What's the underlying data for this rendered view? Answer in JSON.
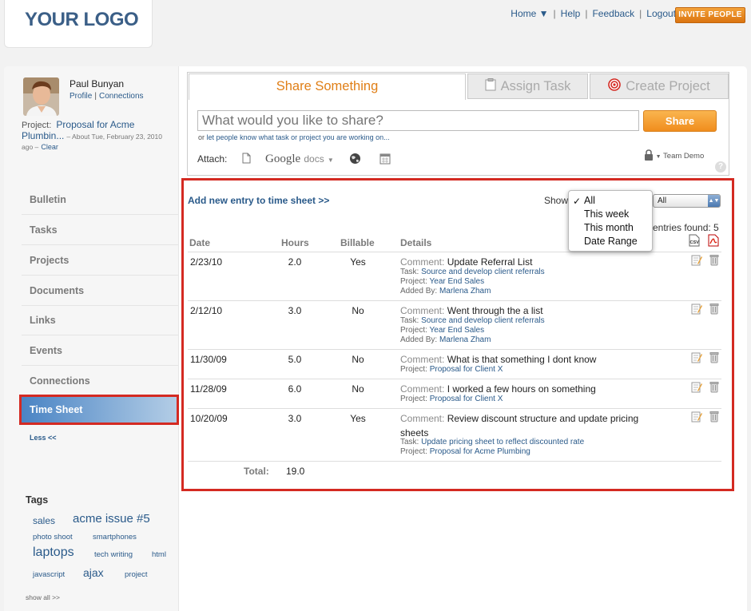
{
  "header": {
    "logo": "YOUR LOGO",
    "nav": [
      "Home ▼",
      "Help",
      "Feedback",
      "Logout"
    ],
    "invite": "INVITE PEOPLE"
  },
  "user": {
    "name": "Paul Bunyan",
    "profile": "Profile",
    "connections": "Connections",
    "project_label": "Project:",
    "project_name": "Proposal for Acme Plumbin...",
    "project_meta": "– About Tue, February 23, 2010 ago –",
    "clear": "Clear"
  },
  "sidebar": {
    "items": [
      "Bulletin",
      "Tasks",
      "Projects",
      "Documents",
      "Links",
      "Events",
      "Connections"
    ],
    "active": "Time Sheet",
    "less": "Less <<"
  },
  "tags": {
    "title": "Tags",
    "items": [
      "sales",
      "acme issue #5",
      "photo shoot",
      "smartphones",
      "laptops",
      "tech writing",
      "html",
      "javascript",
      "ajax",
      "project"
    ],
    "show_all": "show all >>"
  },
  "share": {
    "tabs": [
      "Share Something",
      "Assign Task",
      "Create Project"
    ],
    "placeholder": "What would you like to share?",
    "button": "Share",
    "hint_or": "or",
    "hint_link": "let people know what task or project you are working on...",
    "attach": "Attach:",
    "google": "Google",
    "docs": "docs",
    "team": "Team Demo"
  },
  "timesheet": {
    "add_entry": "Add new entry to time sheet >>",
    "show_label": "Show",
    "select_value": "All",
    "dropdown": [
      "All",
      "This week",
      "This month",
      "Date Range"
    ],
    "dropdown_checked": "✓",
    "entries_found": "entries found: 5",
    "columns": [
      "Date",
      "Hours",
      "Billable",
      "Details"
    ],
    "comment_label": "Comment:",
    "task_label": "Task:",
    "project_label": "Project:",
    "added_label": "Added By:",
    "rows": [
      {
        "date": "2/23/10",
        "hours": "2.0",
        "billable": "Yes",
        "comment": "Update Referral List",
        "task": "Source and develop client referrals",
        "project": "Year End Sales",
        "added_by": "Marlena Zham"
      },
      {
        "date": "2/12/10",
        "hours": "3.0",
        "billable": "No",
        "comment": "Went through the a list",
        "task": "Source and develop client referrals",
        "project": "Year End Sales",
        "added_by": "Marlena Zham"
      },
      {
        "date": "11/30/09",
        "hours": "5.0",
        "billable": "No",
        "comment": "What is that something I dont know",
        "project": "Proposal for Client X"
      },
      {
        "date": "11/28/09",
        "hours": "6.0",
        "billable": "No",
        "comment": "I worked a few hours on something",
        "project": "Proposal for Client X"
      },
      {
        "date": "10/20/09",
        "hours": "3.0",
        "billable": "Yes",
        "comment": "Review discount structure and update pricing",
        "comment2": "sheets",
        "task": "Update pricing sheet to reflect discounted rate",
        "project": "Proposal for Acme Plumbing"
      }
    ],
    "total_label": "Total:",
    "total_value": "19.0"
  }
}
